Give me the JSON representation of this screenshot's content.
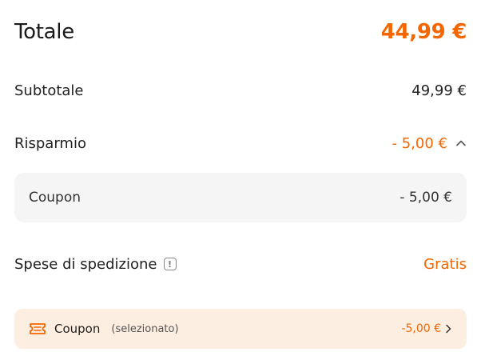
{
  "summary": {
    "total_label": "Totale",
    "total_value": "44,99 €",
    "subtotal_label": "Subtotale",
    "subtotal_value": "49,99 €",
    "savings_label": "Risparmio",
    "savings_value": "- 5,00 €",
    "coupon_label": "Coupon",
    "coupon_value": "- 5,00 €",
    "shipping_label": "Spese di spedizione",
    "shipping_value": "Gratis"
  },
  "coupon_selector": {
    "title": "Coupon",
    "status": "(selezionato)",
    "amount": "-5,00 €"
  },
  "colors": {
    "accent": "#f56600",
    "coupon_box_bg": "#f5f5f5",
    "coupon_selector_bg": "#fdeee2"
  },
  "icons": {
    "savings_toggle": "chevron-up-icon",
    "shipping_info": "info-icon",
    "coupon": "ticket-icon",
    "coupon_open": "chevron-right-icon"
  }
}
